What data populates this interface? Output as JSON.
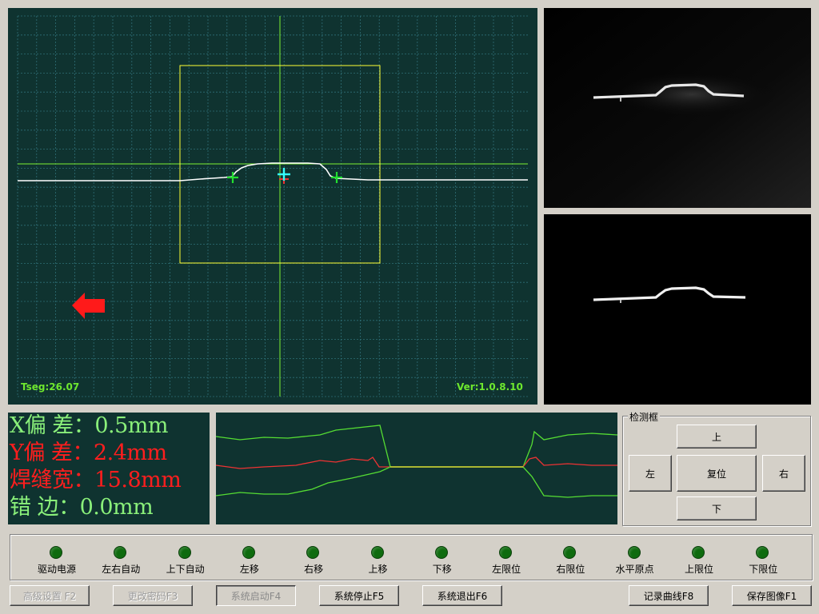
{
  "main_view": {
    "tseg_label": "Tseg:26.07",
    "version_label": "Ver:1.0.8.10"
  },
  "readout": {
    "rows": [
      {
        "label": "X偏 差：",
        "value": "0.5mm",
        "color": "#8af07a"
      },
      {
        "label": "Y偏 差：",
        "value": "2.4mm",
        "color": "#ff1e1e"
      },
      {
        "label": "焊缝宽：",
        "value": "15.8mm",
        "color": "#ff1e1e"
      },
      {
        "label": "错  边：",
        "value": "0.0mm",
        "color": "#8af07a"
      }
    ]
  },
  "detect_box": {
    "title": "检测框",
    "up": "上",
    "left": "左",
    "reset": "复位",
    "right": "右",
    "down": "下"
  },
  "status_leds": [
    {
      "label": "驱动电源",
      "color": "#0e6b0e"
    },
    {
      "label": "左右自动",
      "color": "#0e6b0e"
    },
    {
      "label": "上下自动",
      "color": "#0e6b0e"
    },
    {
      "label": "左移",
      "color": "#0e6b0e"
    },
    {
      "label": "右移",
      "color": "#0e6b0e"
    },
    {
      "label": "上移",
      "color": "#0e6b0e"
    },
    {
      "label": "下移",
      "color": "#0e6b0e"
    },
    {
      "label": "左限位",
      "color": "#0e6b0e"
    },
    {
      "label": "右限位",
      "color": "#0e6b0e"
    },
    {
      "label": "水平原点",
      "color": "#0e6b0e"
    },
    {
      "label": "上限位",
      "color": "#0e6b0e"
    },
    {
      "label": "下限位",
      "color": "#0e6b0e"
    }
  ],
  "toolbar": {
    "advanced": "高级设置 F2",
    "change_password": "更改密码F3",
    "system_start": "系统启动F4",
    "system_stop": "系统停止F5",
    "system_exit": "系统退出F6",
    "record_curve": "记录曲线F8",
    "save_image": "保存图像F1"
  },
  "colors": {
    "panel_bg": "#0f3330",
    "grid": "#2f6f76",
    "crosshair": "#7cf032",
    "roi_box": "#ffff33",
    "profile": "#ffffff",
    "marker_green": "#22e030",
    "marker_cyan": "#33ffff",
    "arrow": "#ff1a1a",
    "trend_outer": "#55dd33",
    "trend_mid": "#ee3333",
    "trend_flat": "#dddd33"
  },
  "icons": {
    "direction_arrow": "left-arrow-icon",
    "marker": "plus-marker-icon"
  }
}
